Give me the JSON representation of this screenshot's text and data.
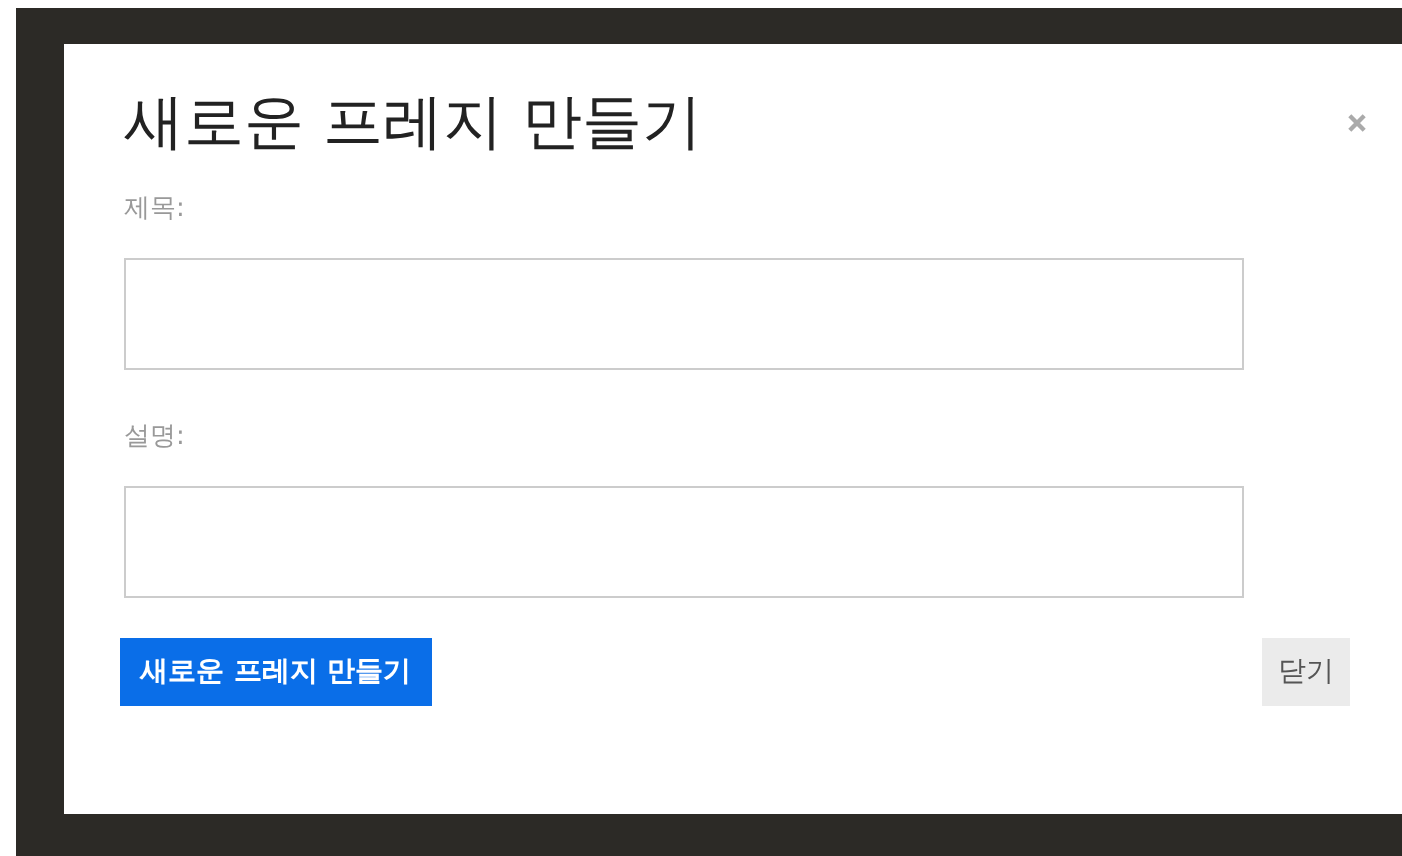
{
  "dialog": {
    "title": "새로운 프레지 만들기",
    "fields": [
      {
        "label": "제목:"
      },
      {
        "label": "설명:"
      }
    ],
    "buttons": [
      {
        "label": "새로운 프레지 만들기",
        "kind": "primary"
      },
      {
        "label": "닫기",
        "kind": "secondary"
      }
    ]
  }
}
